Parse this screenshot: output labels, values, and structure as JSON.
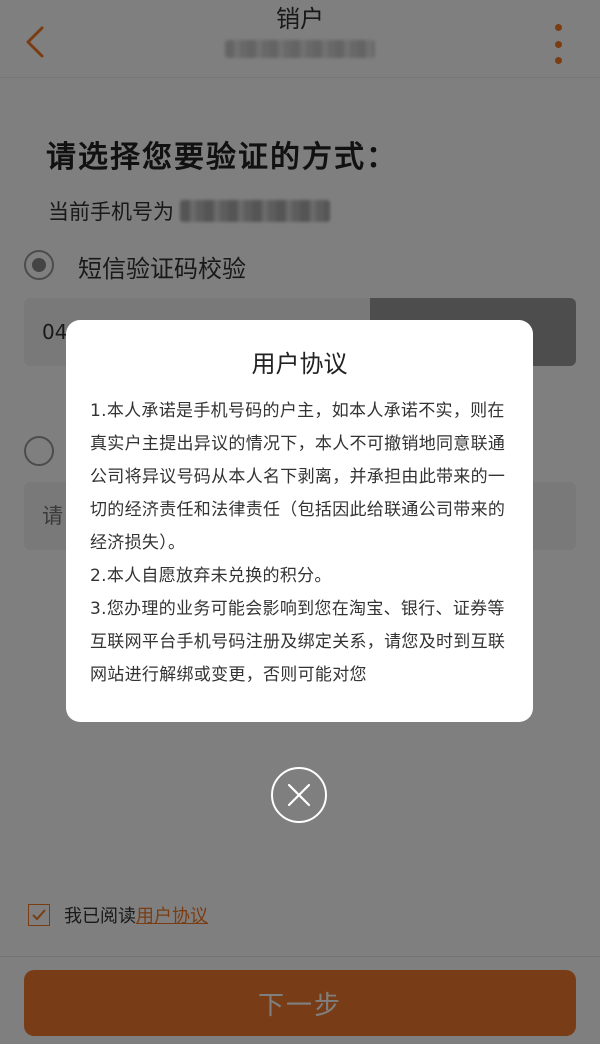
{
  "header": {
    "title": "销户",
    "back_icon": "chevron-left-icon",
    "more_icon": "vertical-dots-icon",
    "accent_color": "#f47b26"
  },
  "main": {
    "heading": "请选择您要验证的方式：",
    "phone_label": "当前手机号为",
    "option_sms_label": "短信验证码校验",
    "code_input_value": "04",
    "second_input_placeholder": "请"
  },
  "agreement": {
    "prefix": "我已阅读",
    "link": "用户协议"
  },
  "next_button": {
    "label": "下一步",
    "color": "#f07a2f"
  },
  "dialog": {
    "title": "用户协议",
    "paragraphs": [
      "1.本人承诺是手机号码的户主，如本人承诺不实，则在真实户主提出异议的情况下，本人不可撤销地同意联通公司将异议号码从本人名下剥离，并承担由此带来的一切的经济责任和法律责任（包括因此给联通公司带来的经济损失）。",
      "2.本人自愿放弃未兑换的积分。",
      "3.您办理的业务可能会影响到您在淘宝、银行、证券等互联网平台手机号码注册及绑定关系，请您及时到互联网站进行解绑或变更，否则可能对您"
    ],
    "close_icon": "close-circle-icon"
  }
}
